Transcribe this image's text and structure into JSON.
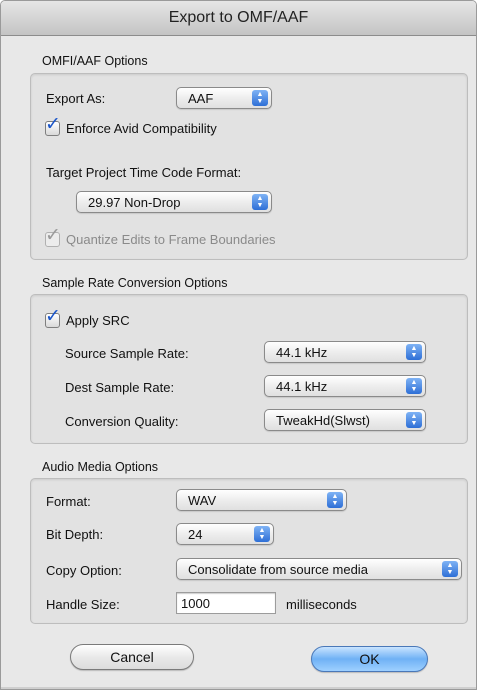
{
  "window": {
    "title": "Export to OMF/AAF"
  },
  "omfi": {
    "section_title": "OMFI/AAF Options",
    "export_as_label": "Export As:",
    "export_as_value": "AAF",
    "enforce_label": "Enforce Avid Compatibility",
    "enforce_checked": true,
    "timecode_label": "Target Project Time Code Format:",
    "timecode_value": "29.97 Non-Drop",
    "quantize_label": "Quantize Edits to Frame Boundaries",
    "quantize_checked": true,
    "quantize_enabled": false
  },
  "src": {
    "section_title": "Sample Rate Conversion Options",
    "apply_label": "Apply SRC",
    "apply_checked": true,
    "source_label": "Source Sample Rate:",
    "source_value": "44.1 kHz",
    "dest_label": "Dest Sample Rate:",
    "dest_value": "44.1 kHz",
    "quality_label": "Conversion Quality:",
    "quality_value": "TweakHd(Slwst)"
  },
  "audio": {
    "section_title": "Audio Media Options",
    "format_label": "Format:",
    "format_value": "WAV",
    "bitdepth_label": "Bit Depth:",
    "bitdepth_value": "24",
    "copy_label": "Copy Option:",
    "copy_value": "Consolidate from source media",
    "handle_label": "Handle Size:",
    "handle_value": "1000",
    "handle_units": "milliseconds"
  },
  "buttons": {
    "cancel": "Cancel",
    "ok": "OK"
  },
  "colors": {
    "checkmark": "#1a55c9",
    "default_button": "#6fb1f5",
    "stepper": "#2e6fd6"
  },
  "icons": {
    "checkbox_mark": "checkmark-icon",
    "popup_arrows": "up-down-arrows-icon"
  }
}
